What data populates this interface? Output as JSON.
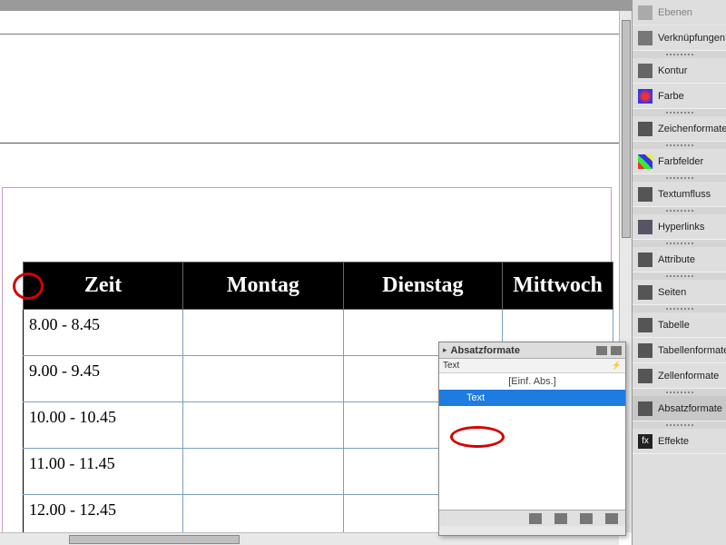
{
  "table": {
    "headers": [
      "Zeit",
      "Montag",
      "Dienstag",
      "Mittwoch"
    ],
    "rows": [
      [
        "8.00 - 8.45",
        "",
        "",
        ""
      ],
      [
        "9.00 - 9.45",
        "",
        "",
        ""
      ],
      [
        "10.00 - 10.45",
        "",
        "",
        ""
      ],
      [
        "11.00 - 11.45",
        "",
        "",
        ""
      ],
      [
        "12.00 - 12.45",
        "",
        "",
        ""
      ]
    ]
  },
  "panels": {
    "items": [
      {
        "label": "Ebenen",
        "icon": "layers-icon"
      },
      {
        "label": "Verknüpfungen",
        "icon": "links-icon"
      },
      {
        "label": "Kontur",
        "icon": "stroke-icon"
      },
      {
        "label": "Farbe",
        "icon": "color-icon"
      },
      {
        "label": "Zeichenformate",
        "icon": "charstyle-icon"
      },
      {
        "label": "Farbfelder",
        "icon": "swatches-icon"
      },
      {
        "label": "Textumfluss",
        "icon": "textwrap-icon"
      },
      {
        "label": "Hyperlinks",
        "icon": "hyperlink-icon"
      },
      {
        "label": "Attribute",
        "icon": "attributes-icon"
      },
      {
        "label": "Seiten",
        "icon": "pages-icon"
      },
      {
        "label": "Tabelle",
        "icon": "table-icon"
      },
      {
        "label": "Tabellenformate",
        "icon": "tablestyle-icon"
      },
      {
        "label": "Zellenformate",
        "icon": "cellstyle-icon"
      },
      {
        "label": "Absatzformate",
        "icon": "parastyle-icon"
      },
      {
        "label": "Effekte",
        "icon": "effects-icon"
      }
    ],
    "active": "Absatzformate"
  },
  "float_panel": {
    "title": "Absatzformate",
    "current": "Text",
    "list": {
      "basic": "[Einf. Abs.]",
      "selected": "Text"
    }
  }
}
